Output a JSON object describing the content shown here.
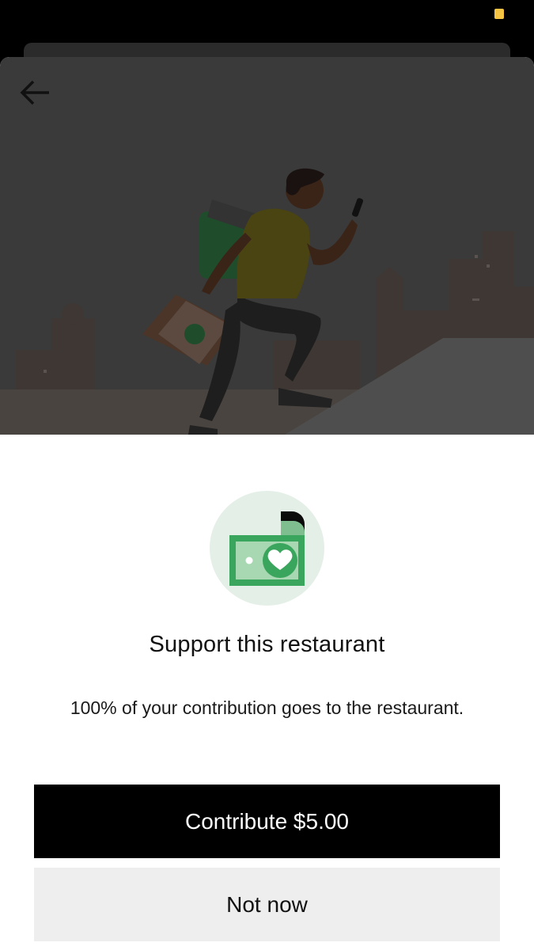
{
  "status_bar": {
    "indicator_color": "#f5c443"
  },
  "header": {
    "back_icon": "arrow-left-icon"
  },
  "hero": {
    "illustration": "courier-running-with-bags-city-illustration"
  },
  "dialog": {
    "icon": "money-heart-icon",
    "title": "Support this restaurant",
    "message": "100% of your contribution goes to the restaurant."
  },
  "actions": {
    "primary_label": "Contribute $5.00",
    "secondary_label": "Not now"
  },
  "colors": {
    "primary_button": "#000000",
    "secondary_button": "#eeeeee",
    "accent_green": "#3aa55c",
    "icon_background": "#e3efe7"
  }
}
